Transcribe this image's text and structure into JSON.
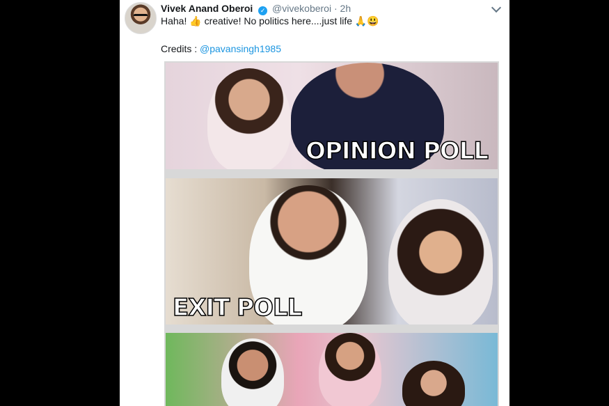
{
  "tweet": {
    "author_name": "Vivek Anand Oberoi",
    "verified_icon": "verified-badge-icon",
    "handle": "@vivekoberoi",
    "separator": "·",
    "time": "2h",
    "text": "Haha! 👍 creative! No politics here....just life 🙏😃",
    "credits_label": "Credits : ",
    "credits_link": "@pavansingh1985"
  },
  "media": {
    "captions": [
      "OPINION POLL",
      "EXIT POLL"
    ]
  },
  "colors": {
    "background": "#000000",
    "card": "#ffffff",
    "link": "#1b95e0",
    "muted": "#657786",
    "verified": "#1da1f2"
  }
}
